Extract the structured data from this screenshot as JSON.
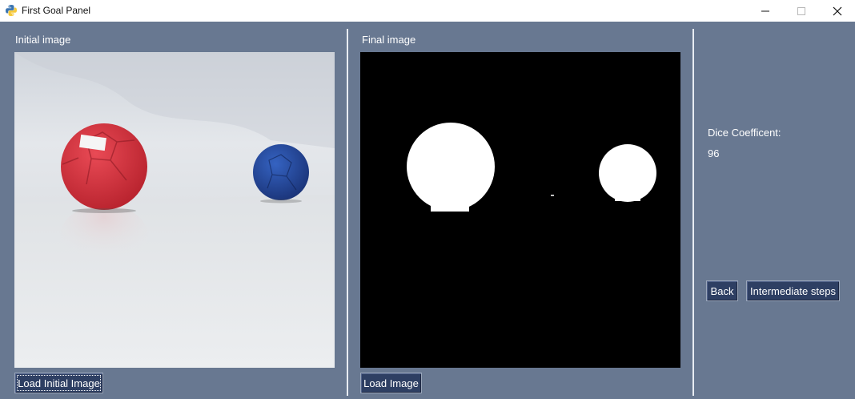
{
  "window": {
    "title": "First Goal Panel",
    "controls": [
      "minimize",
      "maximize",
      "close"
    ]
  },
  "left_panel": {
    "label": "Initial image",
    "image_description_icon": "photo-two-balls",
    "load_button": "Load Initial Image"
  },
  "middle_panel": {
    "label": "Final image",
    "image_description_icon": "segmentation-mask",
    "load_button": "Load Image"
  },
  "right_panel": {
    "dice_label": "Dice Coefficent:",
    "dice_value": "96",
    "back_button": "Back",
    "steps_button": "Intermediate steps"
  },
  "colors": {
    "background": "#687891",
    "button": "#2e3f63",
    "text": "#ffffff",
    "red_ball": "#d8323f",
    "blue_ball": "#25479a"
  }
}
